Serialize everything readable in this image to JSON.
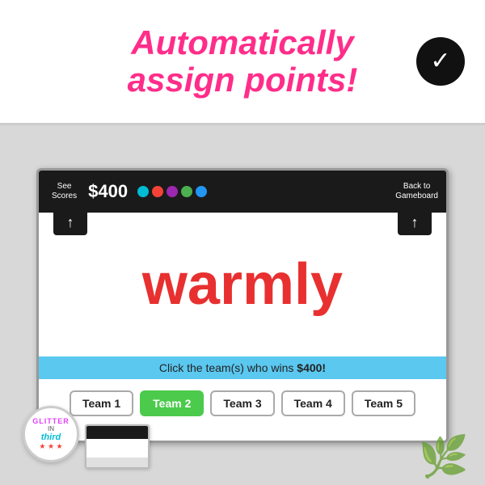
{
  "header": {
    "title_line1": "Automatically",
    "title_line2": "assign points!",
    "check_icon": "✓"
  },
  "whiteboard": {
    "see_scores": "See\nScores",
    "price": "$400",
    "dots": [
      {
        "color": "#00bcd4"
      },
      {
        "color": "#f44336"
      },
      {
        "color": "#9c27b0"
      },
      {
        "color": "#4caf50"
      },
      {
        "color": "#2196f3"
      }
    ],
    "back_to_gameboard": "Back to\nGameboard",
    "up_arrow": "↑",
    "word": "warmly",
    "click_banner_text": "Click the team(s) who wins ",
    "click_banner_amount": "$400!"
  },
  "teams": [
    {
      "label": "Team 1",
      "active": false
    },
    {
      "label": "Team 2",
      "active": true
    },
    {
      "label": "Team 3",
      "active": false
    },
    {
      "label": "Team 4",
      "active": false
    },
    {
      "label": "Team 5",
      "active": false
    }
  ],
  "logo": {
    "glitter": "GLITTER",
    "in": "IN",
    "third": "third",
    "stars": "★ ★ ★"
  }
}
